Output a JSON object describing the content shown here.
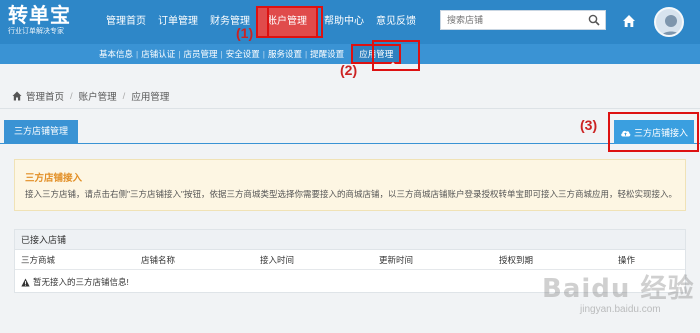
{
  "header": {
    "logo_title": "转单宝",
    "logo_subtitle": "行业订单解决专家",
    "nav": [
      {
        "label": "管理首页"
      },
      {
        "label": "订单管理"
      },
      {
        "label": "财务管理"
      },
      {
        "label": "账户管理",
        "active": true
      },
      {
        "label": "帮助中心"
      },
      {
        "label": "意见反馈"
      }
    ],
    "search_placeholder": "搜索店铺",
    "brand_color": "#2e87c8"
  },
  "subnav": {
    "items": [
      {
        "label": "基本信息"
      },
      {
        "label": "店铺认证"
      },
      {
        "label": "店员管理"
      },
      {
        "label": "安全设置"
      },
      {
        "label": "服务设置"
      },
      {
        "label": "提醒设置"
      },
      {
        "label": "应用管理",
        "active": true
      }
    ],
    "separator": "|"
  },
  "annotations": {
    "marker_1": "(1)",
    "marker_2": "(2)",
    "marker_3": "(3)",
    "highlight_color": "#dd1111"
  },
  "breadcrumb": {
    "items": [
      "管理首页",
      "账户管理",
      "应用管理"
    ],
    "separator": "/"
  },
  "tabs": {
    "active_tab": "三方店铺管理",
    "connect_button": "三方店铺接入"
  },
  "notice": {
    "title": "三方店铺接入",
    "body": "接入三方店铺，请点击右侧\"三方店铺接入\"按钮，依据三方商城类型选择你需要接入的商城店铺，以三方商城店铺账户登录授权转单宝即可接入三方商城应用，轻松实现接入。"
  },
  "connected_stores": {
    "title": "已接入店铺",
    "columns": [
      "三方商城",
      "店铺名称",
      "接入时间",
      "更新时间",
      "授权到期",
      "操作"
    ],
    "empty_message": "暂无接入的三方店铺信息!"
  },
  "watermark": {
    "text": "Baidu 经验",
    "url_text": "jingyan.baidu.com"
  }
}
